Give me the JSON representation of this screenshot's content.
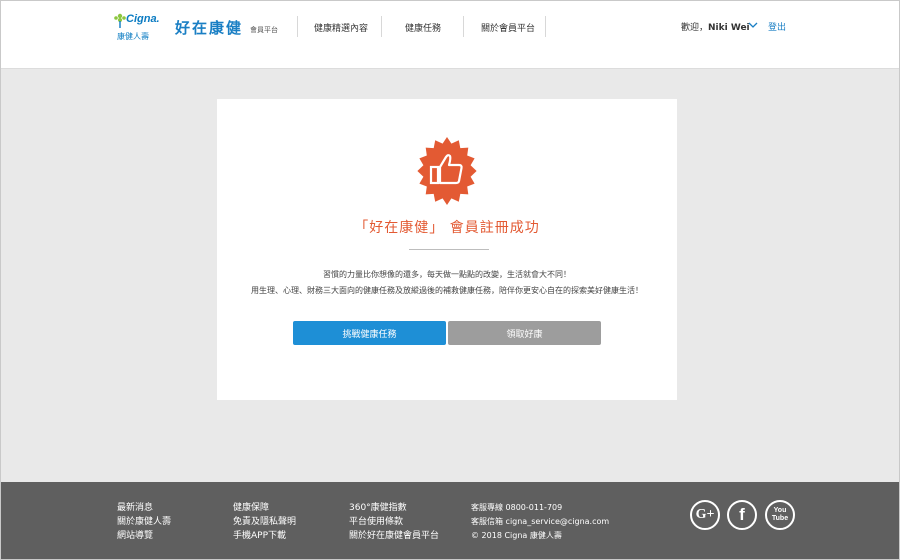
{
  "header": {
    "logo_word": "Cigna.",
    "logo_sub": "康健人壽",
    "brand": "好在康健",
    "brand_sub": "會員平台",
    "nav": [
      "健康精選內容",
      "健康任務",
      "關於會員平台"
    ],
    "welcome_prefix": "歡迎，",
    "user_name": "Niki Wei",
    "logout": "登出"
  },
  "card": {
    "title": "「好在康健」 會員註冊成功",
    "desc_line1": "習慣的力量比你想像的還多，每天做一點點的改變，生活就會大不同！",
    "desc_line2": "用生理、心理、財務三大面向的健康任務及放縱過後的補救健康任務，陪伴你更安心自在的探索美好健康生活！",
    "primary_button": "挑戰健康任務",
    "secondary_button": "領取好康"
  },
  "footer": {
    "col1": [
      "最新消息",
      "關於康健人壽",
      "網站導覽"
    ],
    "col2": [
      "健康保障",
      "免責及隱私聲明",
      "手機APP下載"
    ],
    "col3": [
      "360°康健指數",
      "平台使用條款",
      "關於好在康健會員平台"
    ],
    "contact": [
      "客服專線 0800-011-709",
      "客服信箱 cigna_service@cigna.com",
      "© 2018 Cigna 康健人壽"
    ],
    "social": [
      "G+",
      "f",
      "You Tube"
    ]
  },
  "colors": {
    "brand_blue": "#1a7fc4",
    "badge_orange": "#e35a33",
    "primary_button": "#1e8fd6",
    "secondary_button": "#9d9d9d",
    "footer_bg": "#5f5f5f"
  },
  "icons": {
    "logo": "cigna-tree-icon",
    "badge": "thumbs-up-badge-icon",
    "dropdown": "chevron-down-icon"
  }
}
